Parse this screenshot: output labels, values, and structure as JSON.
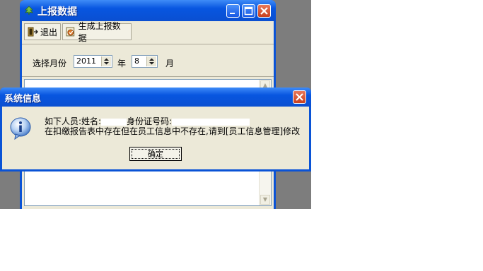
{
  "main_window": {
    "title": "上报数据",
    "toolbar": {
      "exit_label": "退出",
      "generate_label": "生成上报数据"
    },
    "filter": {
      "select_month_label": "选择月份",
      "year_value": "2011",
      "year_suffix": "年",
      "month_value": "8",
      "month_suffix": "月"
    }
  },
  "dialog": {
    "title": "系统信息",
    "line1_prefix": "如下人员:姓名:",
    "line1_id_label": "身份证号码:",
    "line2": "在扣缴报告表中存在但在员工信息中不存在,请到[员工信息管理]修改",
    "ok_label": "确定"
  },
  "icons": [
    "app-icon",
    "minimize-icon",
    "maximize-icon",
    "close-icon",
    "exit-icon",
    "generate-icon",
    "info-icon",
    "spin-up-icon",
    "spin-down-icon"
  ]
}
